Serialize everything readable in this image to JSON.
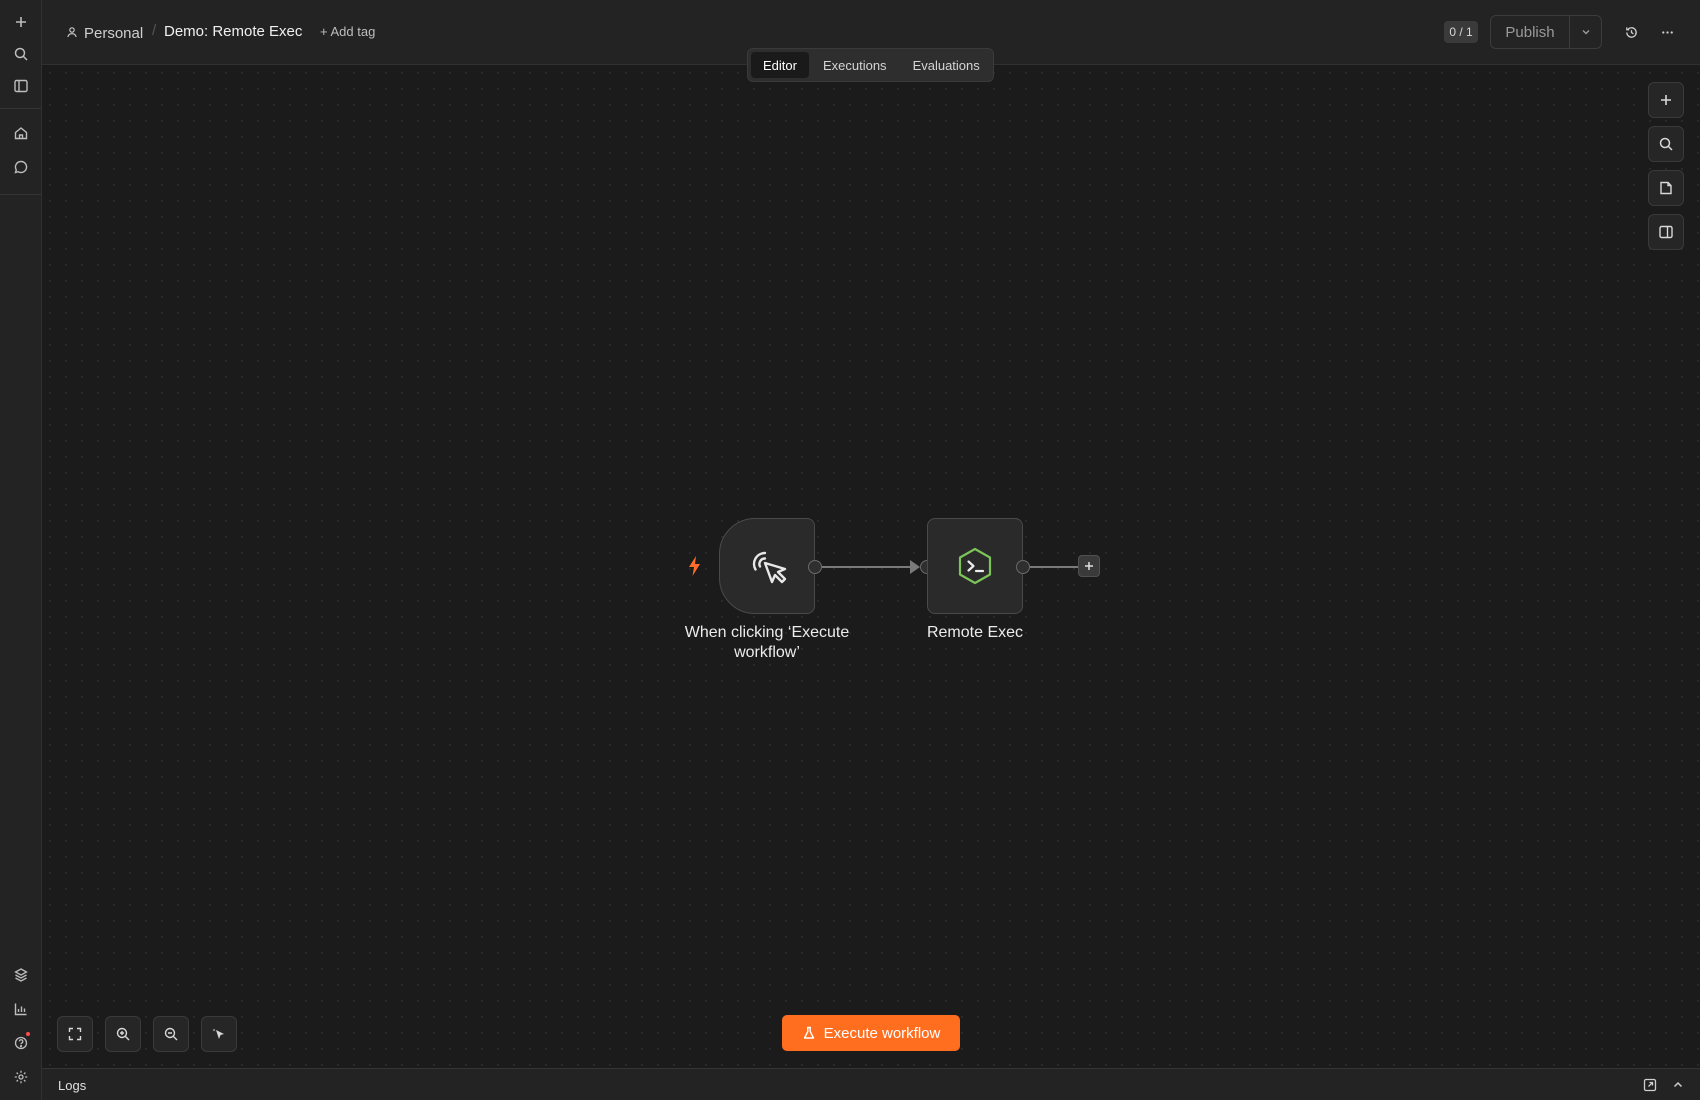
{
  "breadcrumb": {
    "project": "Personal",
    "workflow_title": "Demo: Remote Exec",
    "add_tag": "+ Add tag"
  },
  "header": {
    "counter": "0 / 1",
    "publish_label": "Publish"
  },
  "tabs": [
    {
      "label": "Editor",
      "active": true
    },
    {
      "label": "Executions",
      "active": false
    },
    {
      "label": "Evaluations",
      "active": false
    }
  ],
  "nodes": {
    "trigger": {
      "label": "When clicking ‘Execute workflow’",
      "icon": "cursor-click-icon"
    },
    "exec": {
      "label": "Remote Exec",
      "icon": "terminal-hexagon-icon"
    }
  },
  "canvas": {
    "execute_button": "Execute workflow"
  },
  "logs": {
    "label": "Logs"
  },
  "colors": {
    "accent": "#ff6d1f",
    "exec_icon": "#7cc35a",
    "trigger_bolt": "#ff6d2a"
  }
}
